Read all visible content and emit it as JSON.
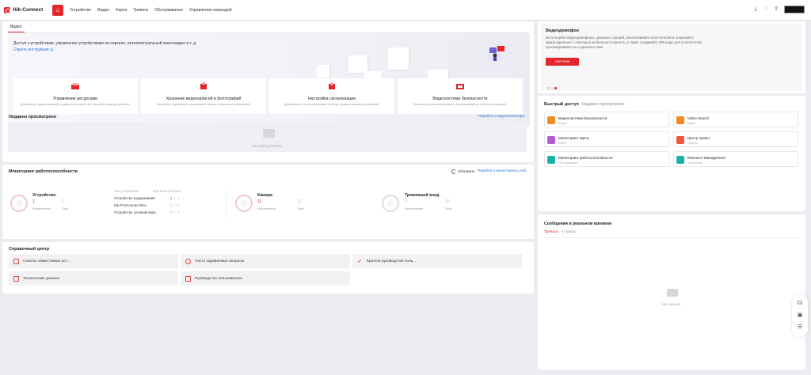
{
  "app": {
    "name": "Hik-Connect"
  },
  "nav": [
    "Устройство",
    "Видео",
    "Карта",
    "Тревога",
    "Обслуживание",
    "Управление командой"
  ],
  "main": {
    "tab": "Видео",
    "description": "Доступ к устройствам, управление устройствами на портале, интеллектуальный поиск видео и т. д.",
    "hide_link": "Скрыть инструкции",
    "features": [
      {
        "title": "Управление ресурсами",
        "desc": "Добавление, редактирование и удаление устройств и настройка видеоустройства."
      },
      {
        "title": "Хранение видеозаписей и фотографий",
        "desc": "Настройка, управление и расписание записи и хранения изображений."
      },
      {
        "title": "Настройка сигнализации",
        "desc": "Добавление и настройка правил тревоги, правила связанных действий."
      },
      {
        "title": "Видеосистема безопасности",
        "desc": "Просмотр в реальном времени, воспроизведение и больше операций."
      }
    ]
  },
  "recent": {
    "title": "Недавно просмотрено",
    "link": "Перейти к видеомонитори...",
    "empty": "No viewing history."
  },
  "health": {
    "title": "Мониторинг работоспособности",
    "refresh": "Обновить",
    "link": "Перейти к мониторингу раб...",
    "device": {
      "title": "Устройство",
      "exception": "1",
      "total": "1",
      "exc_label": "Исключения",
      "total_label": "Total"
    },
    "table_head": {
      "type": "Тип устройства",
      "exc_total": "Исключение/Total"
    },
    "rows": [
      {
        "name": "Устройство кодирования",
        "exc": "1",
        "total": "1"
      },
      {
        "name": "Hik-ProConnect Box",
        "exc": "0",
        "total": "0"
      },
      {
        "name": "Устройство сетевой пере...",
        "exc": "0",
        "total": "0"
      }
    ],
    "camera": {
      "title": "Камера",
      "exception": "11",
      "total": "11",
      "exc_label": "Исключения",
      "total_label": "Total"
    },
    "alarm": {
      "title": "Тревожный вход",
      "exception": "0",
      "total": "16",
      "exc_label": "Исключения",
      "total_label": "Total"
    }
  },
  "help": {
    "title": "Справочный центр",
    "items": [
      "Список совместимых уст...",
      "Часто задаваемые вопросы",
      "Краткое руководство поль...",
      "Технические данные",
      "Руководство пользователя"
    ]
  },
  "doorbell": {
    "title": "Видеодомофон",
    "desc": "Используйте видеодомофоны, дверных станций, распознавайте посетителей и открывайте двери удаленно с помощью мобильного клиента, а также создавайте QR-коды для посетителей, просматривайте их и делитесь ими.",
    "button": "Use Now"
  },
  "quick": {
    "tab_active": "Быстрый доступ",
    "tab_other": "Недавно просмотрено",
    "items": [
      {
        "name": "Видеосистема безопасности",
        "sub": "Видео",
        "color": "#f08a24"
      },
      {
        "name": "Video Search",
        "sub": "Видео",
        "color": "#f08a24"
      },
      {
        "name": "Мониторинг карты",
        "sub": "Карта",
        "color": "#b45bd1"
      },
      {
        "name": "Центр тревог",
        "sub": "Тревога",
        "color": "#f0563b"
      },
      {
        "name": "Мониторинг работоспособности",
        "sub": "Обслуживание",
        "color": "#1ab3a8"
      },
      {
        "name": "Resource Management",
        "sub": "Устройство",
        "color": "#1ab3a8"
      }
    ]
  },
  "realtime": {
    "title": "Сообщения в реальном времени",
    "tab_active": "Тревога",
    "tab_other": "Служба",
    "empty": "Нет данных."
  }
}
